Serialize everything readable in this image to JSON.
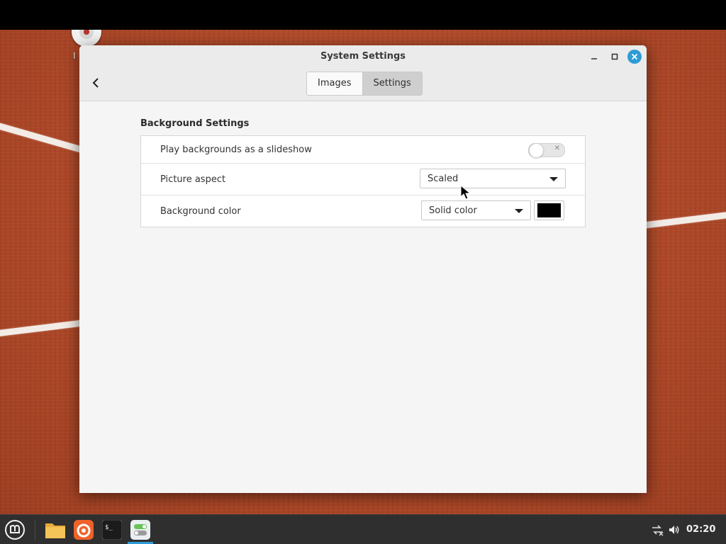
{
  "desktop": {
    "icon_label": "I"
  },
  "window": {
    "title": "System Settings",
    "tabs": [
      {
        "label": "Images",
        "active": false
      },
      {
        "label": "Settings",
        "active": true
      }
    ]
  },
  "background_settings": {
    "section_title": "Background Settings",
    "slideshow": {
      "label": "Play backgrounds as a slideshow",
      "enabled": false
    },
    "picture_aspect": {
      "label": "Picture aspect",
      "value": "Scaled"
    },
    "background_color": {
      "label": "Background color",
      "value": "Solid color",
      "color": "#000000"
    }
  },
  "taskbar": {
    "items": [
      "menu-icon",
      "files-icon",
      "firefox-icon",
      "terminal-icon",
      "settings-icon"
    ],
    "clock": "02:20"
  },
  "colors": {
    "accent": "#2e9bd6",
    "desktop": "#ae4828",
    "taskbar": "#2f2f2f"
  }
}
